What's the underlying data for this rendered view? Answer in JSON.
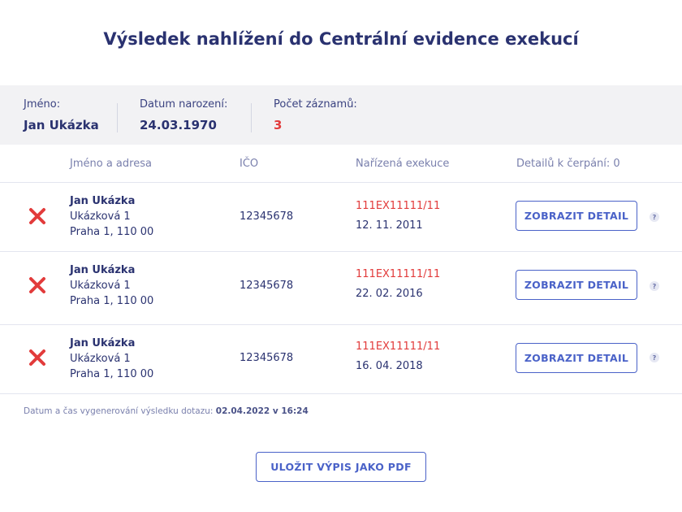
{
  "title": "Výsledek nahlížení do Centrální evidence exekucí",
  "summary": {
    "name_label": "Jméno:",
    "name_value": "Jan Ukázka",
    "birth_label": "Datum narození:",
    "birth_value": "24.03.1970",
    "count_label": "Počet záznamů:",
    "count_value": "3"
  },
  "table": {
    "headers": {
      "name_address": "Jméno a adresa",
      "ico": "IČO",
      "execution": "Nařízená exekuce",
      "details": "Detailů k čerpání: 0"
    },
    "rows": [
      {
        "status_icon": "red-x-icon",
        "name": "Jan Ukázka",
        "street": "Ukázková 1",
        "city": "Praha 1, 110 00",
        "ico": "12345678",
        "execution_number": "111EX11111/11",
        "execution_date": "12. 11. 2011",
        "button_label": "ZOBRAZIT DETAIL",
        "help": "?"
      },
      {
        "status_icon": "red-x-icon",
        "name": "Jan Ukázka",
        "street": "Ukázková 1",
        "city": "Praha 1, 110 00",
        "ico": "12345678",
        "execution_number": "111EX11111/11",
        "execution_date": "22. 02. 2016",
        "button_label": "ZOBRAZIT DETAIL",
        "help": "?"
      },
      {
        "status_icon": "red-x-icon",
        "name": "Jan Ukázka",
        "street": "Ukázková 1",
        "city": "Praha 1, 110 00",
        "ico": "12345678",
        "execution_number": "111EX11111/11",
        "execution_date": "16. 04. 2018",
        "button_label": "ZOBRAZIT DETAIL",
        "help": "?"
      }
    ]
  },
  "footer": {
    "generated_label": "Datum a čas vygenerování výsledku dotazu:",
    "generated_value": "02.04.2022 v 16:24"
  },
  "save_pdf_label": "ULOŽIT VÝPIS JAKO PDF",
  "colors": {
    "accent": "#4a62c8",
    "text": "#2a3270",
    "error": "#e23b3b",
    "summary_bg": "#f2f2f4"
  }
}
